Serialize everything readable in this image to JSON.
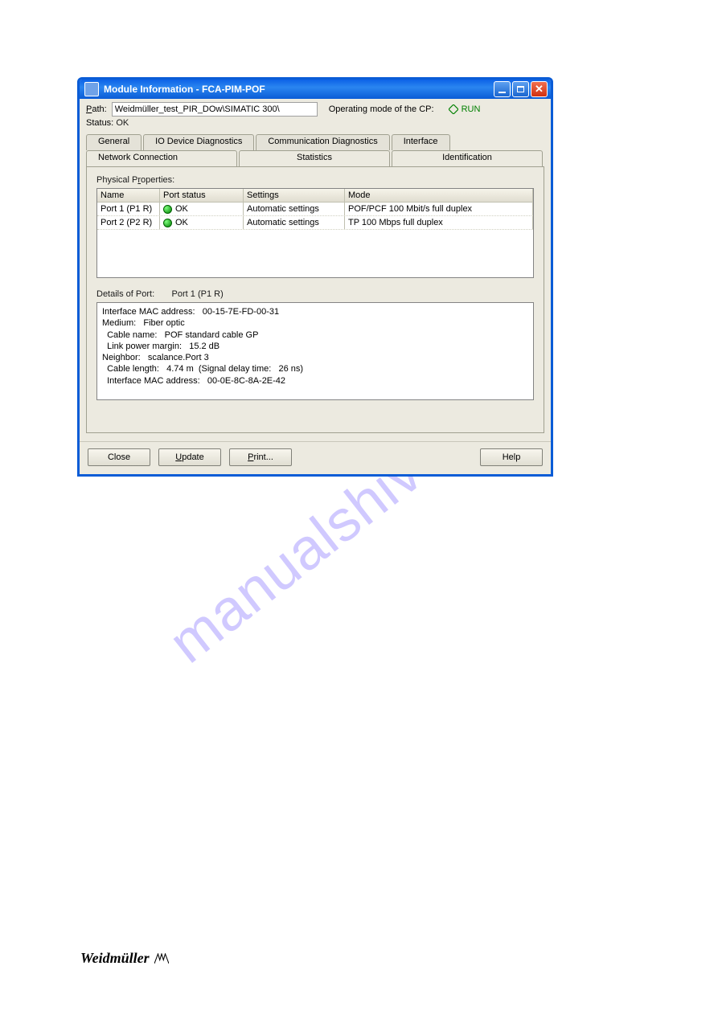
{
  "window": {
    "title": "Module Information - FCA-PIM-POF"
  },
  "top": {
    "path_label": "Path:",
    "path_value": "Weidmüller_test_PIR_DOw\\SIMATIC 300\\",
    "op_mode_label": "Operating mode of the  CP:",
    "run_text": "RUN",
    "status_label": "Status:",
    "status_value": "OK"
  },
  "tabs": {
    "row1": [
      "General",
      "IO Device Diagnostics",
      "Communication Diagnostics",
      "Interface"
    ],
    "row2": [
      "Network Connection",
      "Statistics",
      "Identification"
    ]
  },
  "physical": {
    "label": "Physical Properties:",
    "headers": {
      "name": "Name",
      "status": "Port status",
      "settings": "Settings",
      "mode": "Mode"
    },
    "rows": [
      {
        "name": "Port 1 (P1 R)",
        "status": "OK",
        "settings": "Automatic settings",
        "mode": "POF/PCF 100 Mbit/s full duplex"
      },
      {
        "name": "Port 2 (P2 R)",
        "status": "OK",
        "settings": "Automatic settings",
        "mode": "TP 100 Mbps full duplex"
      }
    ]
  },
  "details": {
    "label_prefix": "Details of Port:",
    "port_name": "Port 1 (P1 R)",
    "text": "Interface MAC address:   00-15-7E-FD-00-31\nMedium:   Fiber optic\n  Cable name:   POF standard cable GP\n  Link power margin:   15.2 dB\nNeighbor:   scalance.Port 3\n  Cable length:   4.74 m  (Signal delay time:   26 ns)\n  Interface MAC address:   00-0E-8C-8A-2E-42"
  },
  "buttons": {
    "close": "Close",
    "update": "Update",
    "print": "Print...",
    "help": "Help"
  },
  "watermark": "manualshive.com",
  "footer": "Weidmüller"
}
